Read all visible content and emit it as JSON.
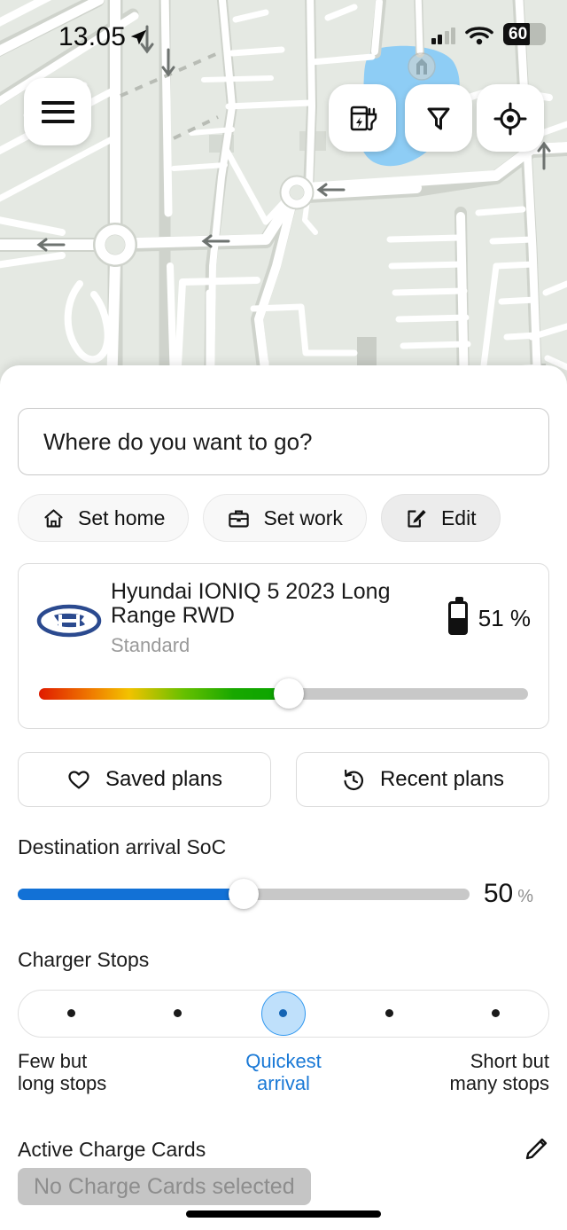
{
  "status_bar": {
    "time": "13.05",
    "location_arrow_icon": "navigation-arrow-icon",
    "signal_icon": "cellular-signal-icon",
    "wifi_icon": "wifi-icon",
    "battery_level": "60",
    "battery_icon": "battery-icon"
  },
  "map": {
    "menu_icon": "hamburger-menu-icon",
    "charger_icon": "charging-station-icon",
    "filter_icon": "filter-funnel-icon",
    "locate_icon": "locate-crosshair-icon",
    "background_color": "#e5e9e3",
    "road_color": "#ffffff",
    "water_color": "#8ecdf5",
    "building_color": "#c9cdc6"
  },
  "sheet": {
    "search": {
      "placeholder": "Where do you want to go?",
      "value": "Where do you want to go?"
    },
    "quick_pills": [
      {
        "label": "Set home",
        "icon": "home-icon",
        "active": false
      },
      {
        "label": "Set work",
        "icon": "briefcase-icon",
        "active": false
      },
      {
        "label": "Edit",
        "icon": "edit-pencil-square-icon",
        "active": true
      }
    ],
    "vehicle": {
      "brand_logo_icon": "hyundai-logo-icon",
      "name": "Hyundai IONIQ 5 2023 Long Range RWD",
      "variant": "Standard",
      "battery_icon": "battery-vertical-icon",
      "soc_text": "51 %",
      "soc_percent": 51,
      "slider_gradient": [
        "#e01b00",
        "#f2c200",
        "#09a400"
      ],
      "slider_inactive_color": "#c8c8c8"
    },
    "plan_buttons": [
      {
        "label": "Saved plans",
        "icon": "heart-icon"
      },
      {
        "label": "Recent plans",
        "icon": "history-clock-icon"
      }
    ],
    "destination_soc": {
      "label": "Destination arrival SoC",
      "value": "50",
      "unit": "%",
      "percent": 50,
      "accent_color": "#1271d6"
    },
    "charger_stops": {
      "label": "Charger Stops",
      "dot_count": 5,
      "selected_index": 2,
      "selected_color": "#1a79d6",
      "labels": {
        "left": "Few but\nlong stops",
        "middle": "Quickest\narrival",
        "right": "Short but\nmany stops"
      },
      "label_left_line1": "Few but",
      "label_left_line2": "long stops",
      "label_mid_line1": "Quickest",
      "label_mid_line2": "arrival",
      "label_right_line1": "Short but",
      "label_right_line2": "many stops"
    },
    "charge_cards": {
      "label": "Active Charge Cards",
      "edit_icon": "pencil-icon",
      "chip_text": "No Charge Cards selected"
    }
  }
}
